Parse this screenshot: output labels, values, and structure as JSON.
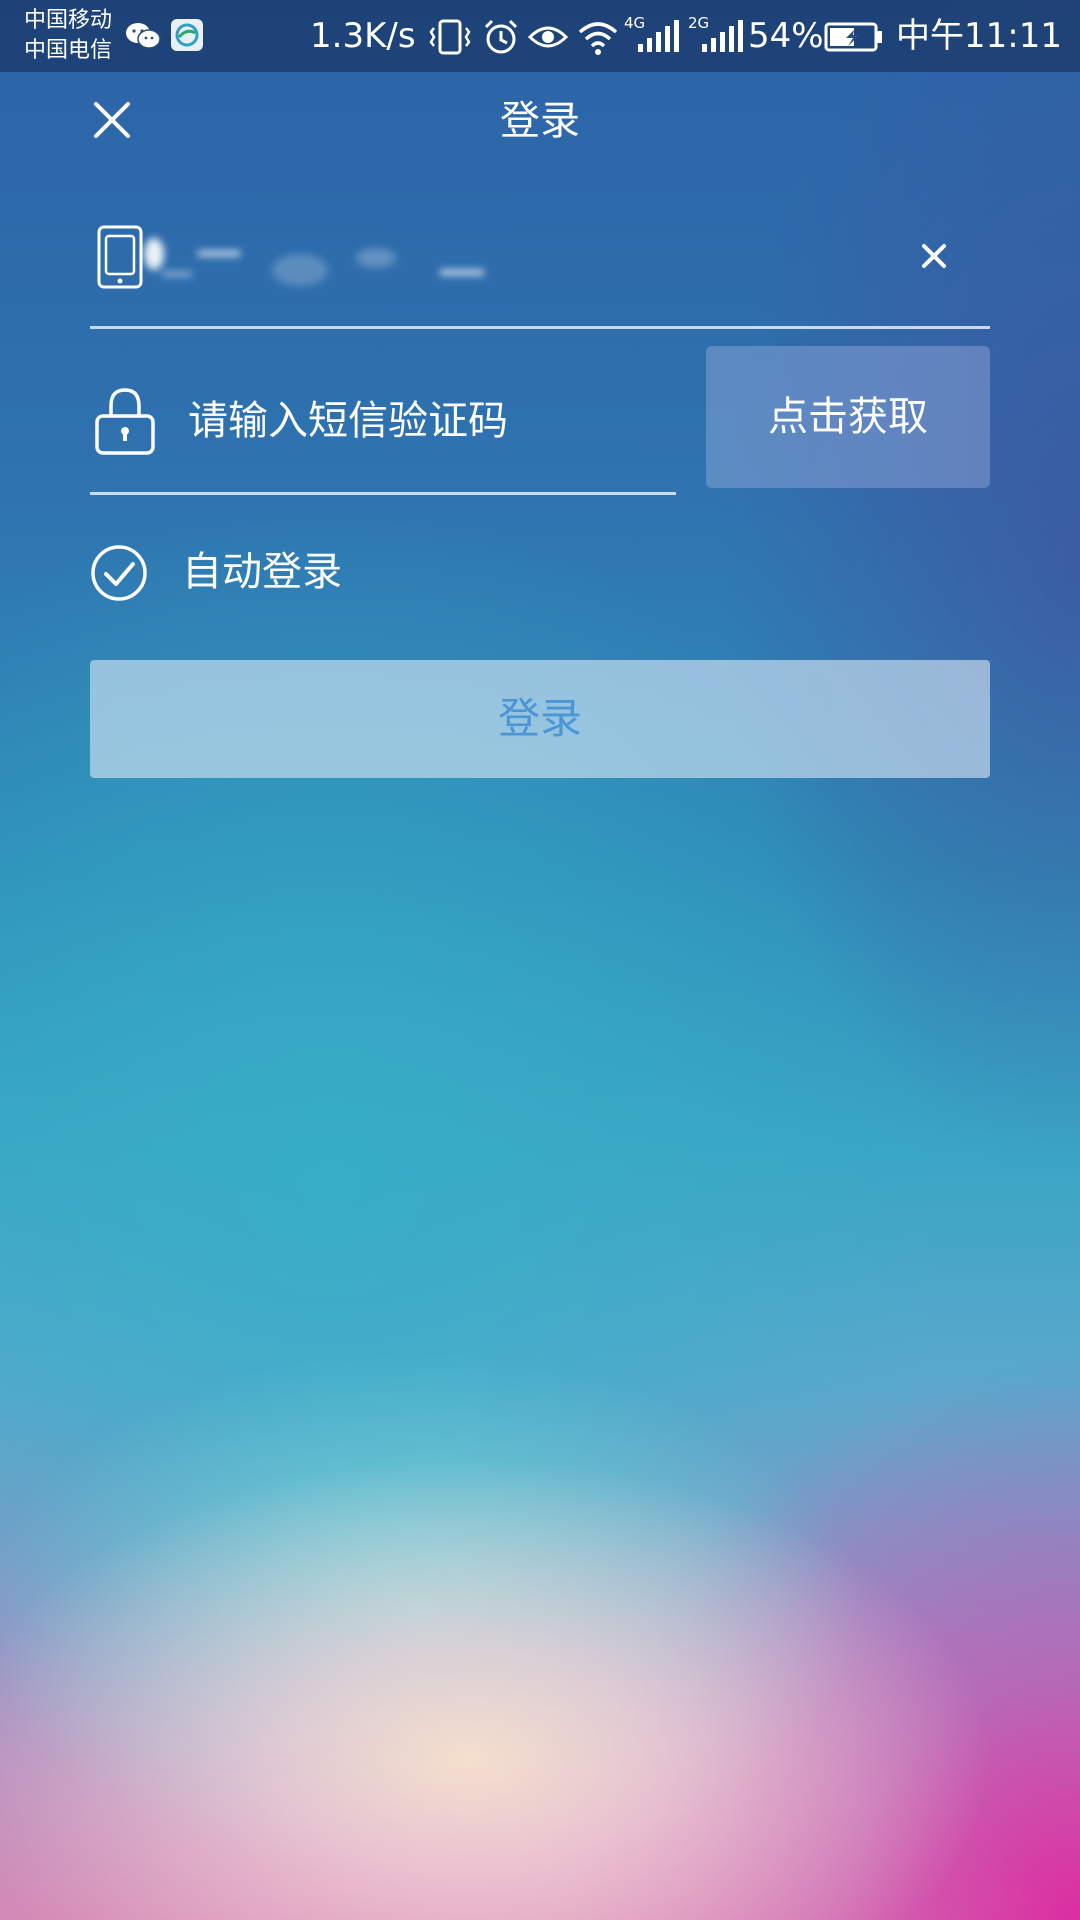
{
  "status_bar": {
    "carrier_1": "中国移动",
    "carrier_2": "中国电信",
    "network_speed": "1.3K/s",
    "network_4g": "4G",
    "network_2g": "2G",
    "battery": "54%",
    "time": "中午11:11",
    "icons": [
      "wechat-icon",
      "china-mobile-icon",
      "vibrate-icon",
      "alarm-icon",
      "eye-comfort-icon",
      "wifi-icon",
      "signal-4g-icon",
      "signal-2g-icon",
      "battery-charging-icon"
    ]
  },
  "header": {
    "title": "登录"
  },
  "form": {
    "phone": {
      "value": "",
      "icon": "phone-icon"
    },
    "code": {
      "placeholder": "请输入短信验证码",
      "icon": "lock-icon"
    },
    "get_code_label": "点击获取",
    "auto_login_label": "自动登录",
    "auto_login_checked": true,
    "login_label": "登录"
  },
  "colors": {
    "login_button_text": "#4a96d6",
    "accent_white": "#ffffff"
  }
}
